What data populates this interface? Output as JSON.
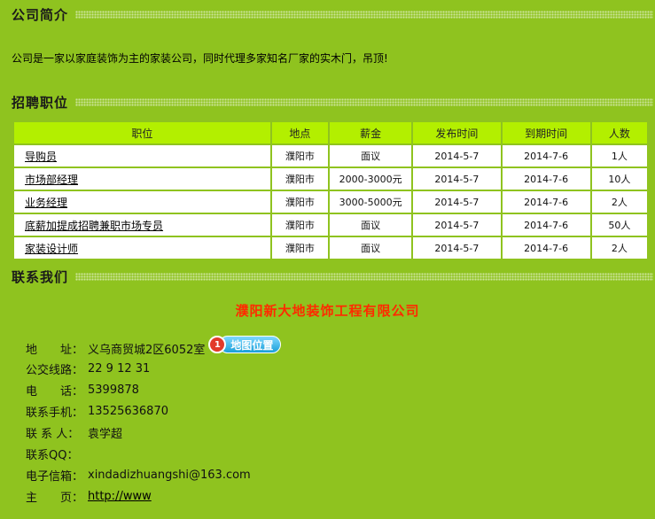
{
  "sections": {
    "intro_title": "公司简介",
    "jobs_title": "招聘职位",
    "contact_title": "联系我们"
  },
  "intro_text": "公司是一家以家庭装饰为主的家装公司，同时代理多家知名厂家的实木门，吊顶!",
  "jobs": {
    "headers": [
      "职位",
      "地点",
      "薪金",
      "发布时间",
      "到期时间",
      "人数"
    ],
    "rows": [
      {
        "position": "导购员",
        "location": "濮阳市",
        "salary": "面议",
        "posted": "2014-5-7",
        "expires": "2014-7-6",
        "count": "1人"
      },
      {
        "position": "市场部经理",
        "location": "濮阳市",
        "salary": "2000-3000元",
        "posted": "2014-5-7",
        "expires": "2014-7-6",
        "count": "10人"
      },
      {
        "position": "业务经理",
        "location": "濮阳市",
        "salary": "3000-5000元",
        "posted": "2014-5-7",
        "expires": "2014-7-6",
        "count": "2人"
      },
      {
        "position": "底薪加提成招聘兼职市场专员",
        "location": "濮阳市",
        "salary": "面议",
        "posted": "2014-5-7",
        "expires": "2014-7-6",
        "count": "50人"
      },
      {
        "position": "家装设计师",
        "location": "濮阳市",
        "salary": "面议",
        "posted": "2014-5-7",
        "expires": "2014-7-6",
        "count": "2人"
      }
    ]
  },
  "company_name": "濮阳新大地装饰工程有限公司",
  "contact": {
    "address_label": "地　　址：",
    "address_value": "义乌商贸城2区6052室",
    "map_pin": "1",
    "map_button": "地图位置",
    "bus_label": "公交线路：",
    "bus_value": "22 9 12 31",
    "phone_label": "电　　话：",
    "phone_value": "5399878",
    "mobile_label": "联系手机：",
    "mobile_value": "13525636870",
    "person_label": "联 系 人：",
    "person_value": "袁学超",
    "qq_label": "联系QQ：",
    "qq_value": "",
    "email_label": "电子信箱：",
    "email_value": "xindadizhuangshi@163.com",
    "homepage_label": "主　　页：",
    "homepage_value": "http://www"
  }
}
